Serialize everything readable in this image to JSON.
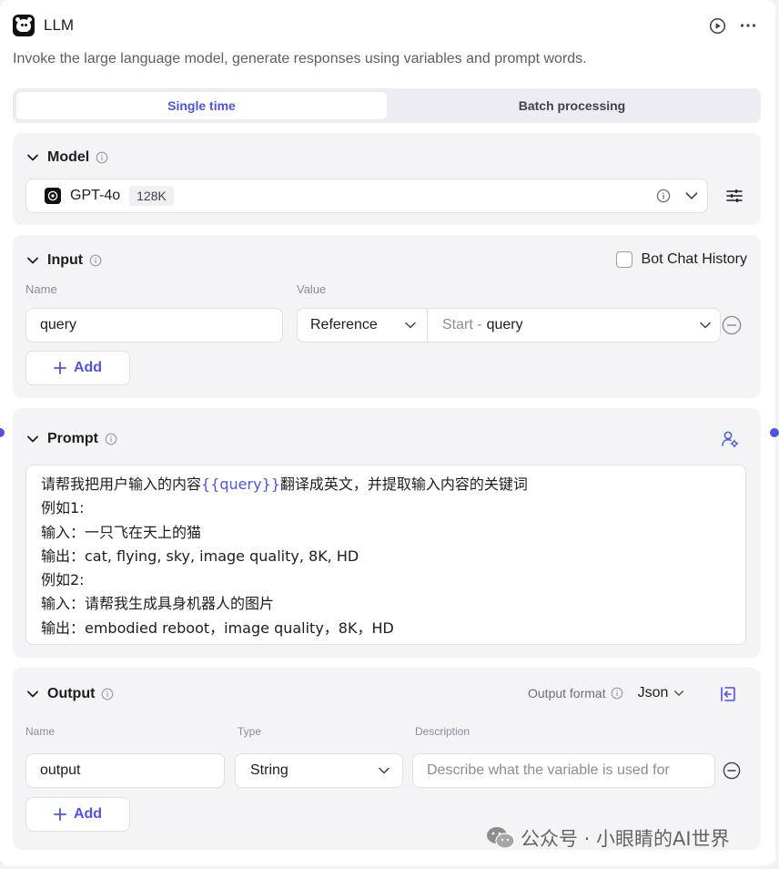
{
  "header": {
    "title": "LLM",
    "description": "Invoke the large language model, generate responses using variables and prompt words."
  },
  "tabs": {
    "single": "Single time",
    "batch": "Batch processing"
  },
  "model": {
    "section_title": "Model",
    "name": "GPT-4o",
    "context": "128K"
  },
  "input": {
    "section_title": "Input",
    "bot_chat_history_label": "Bot Chat History",
    "name_header": "Name",
    "value_header": "Value",
    "row": {
      "name": "query",
      "type": "Reference",
      "ref_prefix": "Start - ",
      "ref_var": "query"
    },
    "add_label": "Add"
  },
  "prompt": {
    "section_title": "Prompt",
    "line1_before": "请帮我把用户输入的内容",
    "line1_var": "{{query}}",
    "line1_after": "翻译成英文，并提取输入内容的关键词",
    "line2": "例如1:",
    "line3": "输入：一只飞在天上的猫",
    "line4": "输出：cat, flying, sky, image quality, 8K, HD",
    "line5": "例如2:",
    "line6": "输入：请帮我生成具身机器人的图片",
    "line7": "输出：embodied reboot，image quality，8K，HD"
  },
  "output": {
    "section_title": "Output",
    "format_label": "Output format",
    "format_value": "Json",
    "name_header": "Name",
    "type_header": "Type",
    "desc_header": "Description",
    "row": {
      "name": "output",
      "type": "String",
      "desc_placeholder": "Describe what the variable is used for"
    },
    "add_label": "Add"
  },
  "watermark": {
    "text": "公众号 · 小眼睛的AI世界"
  },
  "colors": {
    "accent": "#4d53e8",
    "section_bg": "#f4f4f7",
    "border": "#dfe0e6"
  }
}
